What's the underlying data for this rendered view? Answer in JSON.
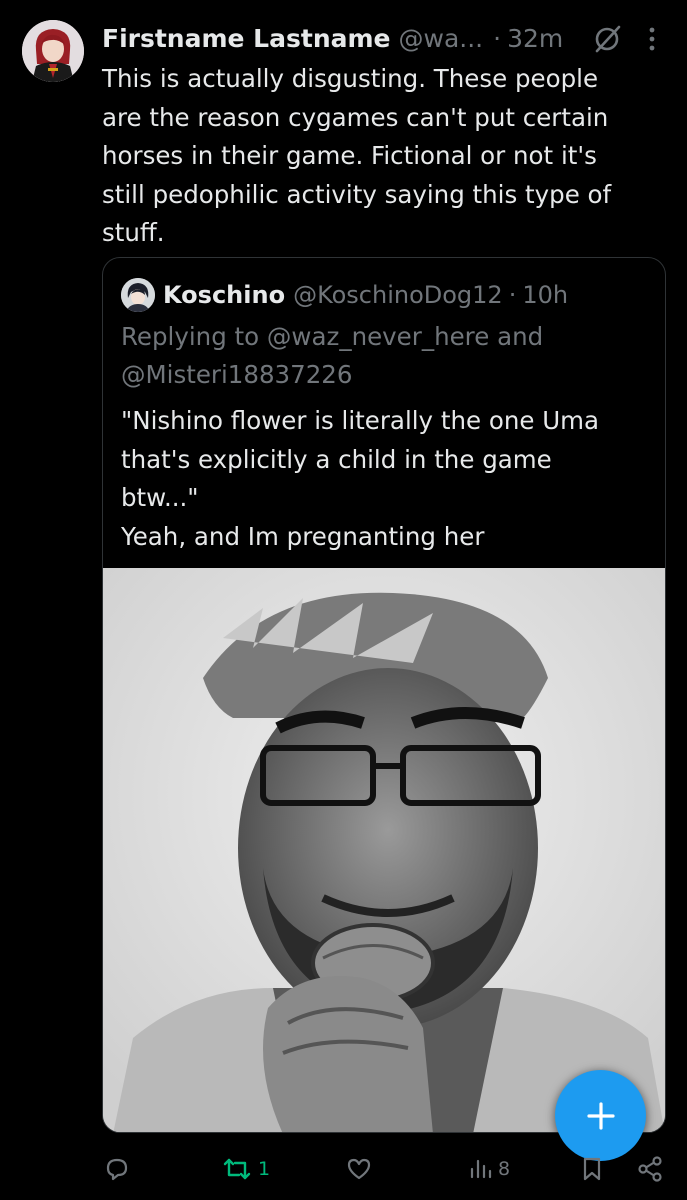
{
  "tweet": {
    "author_name": "Firstname Lastname",
    "author_handle": "@wa...",
    "separator": "·",
    "time": "32m",
    "text": "This is actually disgusting. These people\nare the reason cygames can't put certain\nhorses in their game. Fictional or not it's\nstill pedophilic activity saying this type of\nstuff.",
    "icons": {
      "grok": "grok-icon",
      "more": "more-vertical-icon"
    }
  },
  "quote": {
    "author_name": "Koschino",
    "author_handle": "@KoschinoDog12",
    "separator": "·",
    "time": "10h",
    "replying_prefix": "Replying to",
    "replying_user1": "@waz_never_here",
    "replying_and": "and",
    "replying_user2": "@Misteri18837226",
    "text": "\"Nishino flower is literally the one Uma\nthat's explicitly a child in the game\nbtw...\"\nYeah, and Im pregnanting her"
  },
  "actions": {
    "reply_count": "",
    "retweet_count": "1",
    "like_count": "",
    "views_count": "8"
  },
  "colors": {
    "background": "#000000",
    "text": "#e7e9ea",
    "secondary": "#71767b",
    "accent": "#1d9bf0",
    "retweet_active": "#00ba7c",
    "border": "#2f3336"
  },
  "fab": {
    "icon": "plus-icon"
  }
}
